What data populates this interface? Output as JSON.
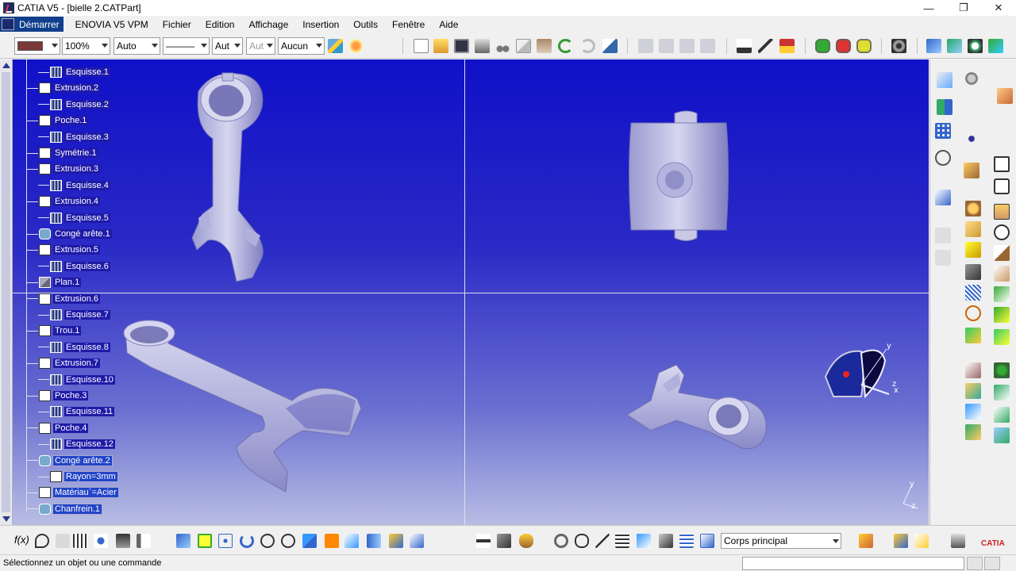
{
  "window": {
    "title": "CATIA V5 - [bielle 2.CATPart]",
    "minimize": "—",
    "restore": "❐",
    "close": "✕"
  },
  "menu": {
    "start": "Démarrer",
    "items": [
      "ENOVIA V5 VPM",
      "Fichier",
      "Edition",
      "Affichage",
      "Insertion",
      "Outils",
      "Fenêtre",
      "Aide"
    ]
  },
  "toolbar": {
    "color_swatch": "#7a3a3a",
    "zoom_combo": "100%",
    "auto_combo": "Auto",
    "line_combo": "———",
    "weight_combo": "Aut",
    "weight_combo2": "Aut",
    "layer_combo": "Aucun"
  },
  "tree": {
    "items": [
      {
        "label": "Esquisse.1",
        "type": "sketch"
      },
      {
        "label": "Extrusion.2",
        "type": "feat"
      },
      {
        "label": "Esquisse.2",
        "type": "sketch"
      },
      {
        "label": "Poche.1",
        "type": "feat"
      },
      {
        "label": "Esquisse.3",
        "type": "sketch"
      },
      {
        "label": "Symétrie.1",
        "type": "feat"
      },
      {
        "label": "Extrusion.3",
        "type": "feat"
      },
      {
        "label": "Esquisse.4",
        "type": "sketch"
      },
      {
        "label": "Extrusion.4",
        "type": "feat"
      },
      {
        "label": "Esquisse.5",
        "type": "sketch"
      },
      {
        "label": "Congé arête.1",
        "type": "fillet"
      },
      {
        "label": "Extrusion.5",
        "type": "feat"
      },
      {
        "label": "Esquisse.6",
        "type": "sketch"
      },
      {
        "label": "Plan.1",
        "type": "plane"
      },
      {
        "label": "Extrusion.6",
        "type": "feat"
      },
      {
        "label": "Esquisse.7",
        "type": "sketch"
      },
      {
        "label": "Trou.1",
        "type": "feat"
      },
      {
        "label": "Esquisse.8",
        "type": "sketch"
      },
      {
        "label": "Extrusion.7",
        "type": "feat"
      },
      {
        "label": "Esquisse.10",
        "type": "sketch"
      },
      {
        "label": "Poche.3",
        "type": "feat"
      },
      {
        "label": "Esquisse.11",
        "type": "sketch"
      },
      {
        "label": "Poche.4",
        "type": "feat"
      },
      {
        "label": "Esquisse.12",
        "type": "sketch"
      },
      {
        "label": "Congé arête.2",
        "type": "fillet"
      },
      {
        "label": "Rayon=3mm",
        "type": "param"
      },
      {
        "label": "Matériau`=Acier",
        "type": "mat"
      },
      {
        "label": "Chanfrein.1",
        "type": "chamfer"
      }
    ]
  },
  "compass": {
    "x": "x",
    "y": "y",
    "z": "z"
  },
  "bottombar": {
    "body_combo": "Corps principal",
    "fx_label": "f(x)"
  },
  "status": {
    "message": "Sélectionnez un objet ou une commande"
  },
  "colors": {
    "viewport_top": "#1010c8",
    "viewport_bottom": "#b8bde4",
    "part": "#c8c8e8",
    "selection": "#1f1ba8"
  }
}
